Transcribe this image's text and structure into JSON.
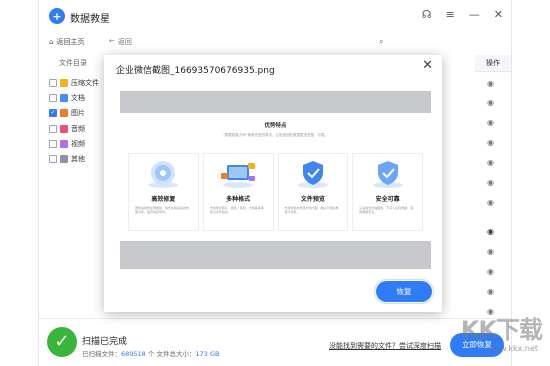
{
  "app": {
    "title": "数据救星",
    "back_home_label": "返回主页",
    "back_label": "返回"
  },
  "sidebar": {
    "title": "文件目录",
    "items": [
      {
        "label": "压缩文件",
        "checked": false,
        "color": "#f3b21a"
      },
      {
        "label": "文档",
        "checked": false,
        "color": "#4a8df6"
      },
      {
        "label": "图片",
        "checked": true,
        "color": "#f07b2e"
      },
      {
        "label": "音频",
        "checked": false,
        "color": "#f04e79"
      },
      {
        "label": "视频",
        "checked": false,
        "color": "#b06cf5"
      },
      {
        "label": "其他",
        "checked": false,
        "color": "#8a94a6"
      }
    ]
  },
  "table": {
    "action_header": "操作"
  },
  "modal": {
    "title": "企业微信截图_16693570676935.png",
    "recover_label": "恢复",
    "preview": {
      "heading": "优势特点",
      "subtitle": "“数据救星大师”使用先进的算法，让您找回的数据更加完整、可靠。",
      "cards": [
        {
          "title": "高效修复",
          "desc": "更快速地恢复误删除、格式化等丢失的数据文件，提高恢复效率。"
        },
        {
          "title": "多种格式",
          "desc": "支持恢复照片、视频、音频、文档等多种常见文件格式。"
        },
        {
          "title": "文件预览",
          "desc": "支持恢复前预览文件内容，确认无误后再进行恢复。"
        },
        {
          "title": "安全可靠",
          "desc": "只读模式扫描磁盘，不写入任何数据，保障数据安全。"
        }
      ]
    }
  },
  "bottom": {
    "status": "扫描已完成",
    "scanned_label": "已扫描文件：",
    "scanned_count": "689518",
    "size_label": "个 文件总大小：",
    "size_value": "173 GB",
    "deep_scan_link": "没能找到需要的文件？尝试深度扫描",
    "recover_now": "立即恢复"
  },
  "watermark": {
    "brand": "KK下载",
    "url": "www.kkx.net"
  },
  "colors": {
    "accent": "#2f7cf6",
    "success": "#38b53a"
  }
}
